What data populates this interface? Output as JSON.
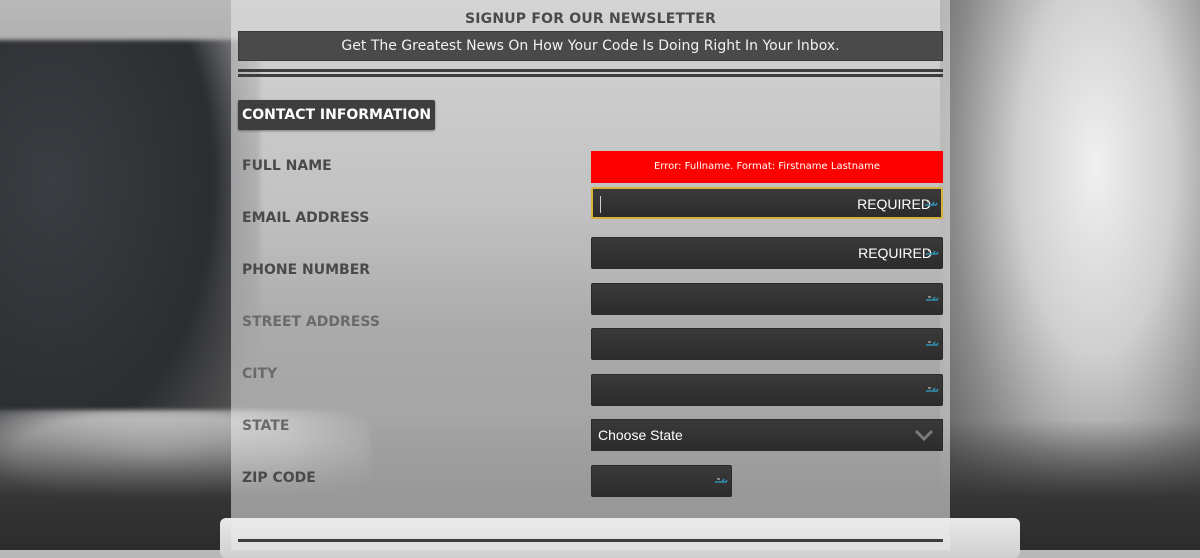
{
  "newsletter": {
    "heading": "SIGNUP FOR OUR NEWSLETTER",
    "tagline": "Get The Greatest News On How Your Code Is Doing Right In Your Inbox."
  },
  "section": {
    "title": "CONTACT INFORMATION"
  },
  "labels": {
    "full_name": "FULL NAME",
    "email": "EMAIL ADDRESS",
    "phone": "PHONE NUMBER",
    "street": "STREET ADDRESS",
    "city": "CITY",
    "state": "STATE",
    "zip": "ZIP CODE"
  },
  "error": {
    "full_name": "Error: Fullname. Format: Firstname Lastname"
  },
  "fields": {
    "full_name_required": "REQUIRED",
    "email_required": "REQUIRED",
    "state_selected": "Choose State"
  },
  "colors": {
    "error": "#ff0000",
    "focus_border": "#d7b23c",
    "field_bg": "#333333",
    "panel_text": "#4a4a4a"
  },
  "icons": {
    "field_icon": "key-icon",
    "select_icon": "chevron-down-icon"
  }
}
